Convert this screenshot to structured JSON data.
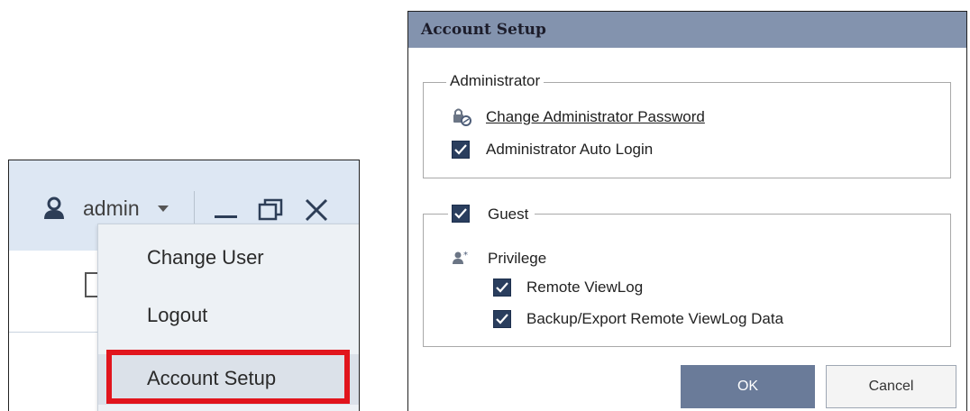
{
  "user_menu": {
    "username": "admin",
    "items": [
      {
        "label": "Change User"
      },
      {
        "label": "Logout"
      },
      {
        "label": "Account Setup"
      }
    ],
    "highlight_color": "#e1151d",
    "icons": [
      "user-icon",
      "caret-down-icon",
      "minimize-icon",
      "restore-icon",
      "close-icon"
    ]
  },
  "dialog": {
    "title": "Account Setup",
    "administrator": {
      "legend": "Administrator",
      "change_password_label": "Change Administrator Password",
      "auto_login_label": "Administrator Auto Login",
      "auto_login_checked": true
    },
    "guest": {
      "legend": "Guest",
      "checked": true,
      "privilege_label": "Privilege",
      "remote_viewlog_label": "Remote ViewLog",
      "remote_viewlog_checked": true,
      "backup_label": "Backup/Export Remote ViewLog Data",
      "backup_checked": true
    },
    "ok_label": "OK",
    "cancel_label": "Cancel",
    "accent_color": "#6a7b99",
    "title_color": "#8393ae"
  }
}
